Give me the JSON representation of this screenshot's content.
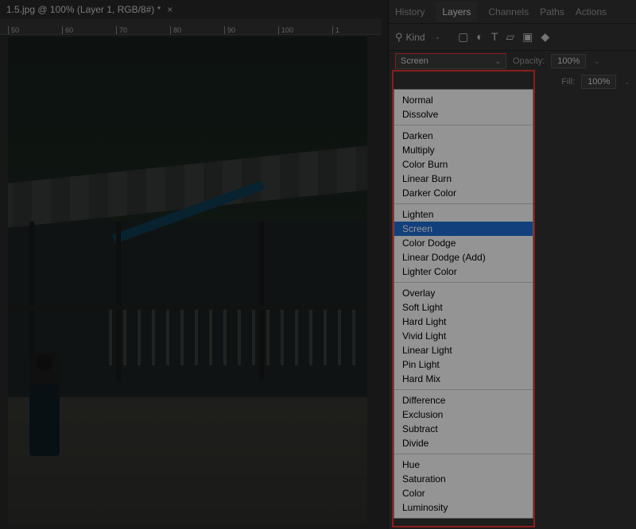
{
  "doc": {
    "title": "1.5.jpg @ 100% (Layer 1, RGB/8#) *"
  },
  "ruler": [
    "50",
    "60",
    "70",
    "80",
    "90",
    "100",
    "1"
  ],
  "panel_tabs": {
    "history": "History",
    "layers": "Layers",
    "channels": "Channels",
    "paths": "Paths",
    "actions": "Actions"
  },
  "filter_row": {
    "search_icon": "⚲",
    "kind_label": "Kind",
    "img_icon": "▢",
    "adjust_icon": "◐",
    "type_icon": "T",
    "shape_icon": "▱",
    "smart_icon": "▣",
    "artboard_icon": "◆"
  },
  "opacity": {
    "label": "Opacity:",
    "value": "100%"
  },
  "fill": {
    "label": "Fill:",
    "value": "100%"
  },
  "blend_dropdown": {
    "selected": "Screen",
    "groups": [
      [
        "Normal",
        "Dissolve"
      ],
      [
        "Darken",
        "Multiply",
        "Color Burn",
        "Linear Burn",
        "Darker Color"
      ],
      [
        "Lighten",
        "Screen",
        "Color Dodge",
        "Linear Dodge (Add)",
        "Lighter Color"
      ],
      [
        "Overlay",
        "Soft Light",
        "Hard Light",
        "Vivid Light",
        "Linear Light",
        "Pin Light",
        "Hard Mix"
      ],
      [
        "Difference",
        "Exclusion",
        "Subtract",
        "Divide"
      ],
      [
        "Hue",
        "Saturation",
        "Color",
        "Luminosity"
      ]
    ]
  }
}
